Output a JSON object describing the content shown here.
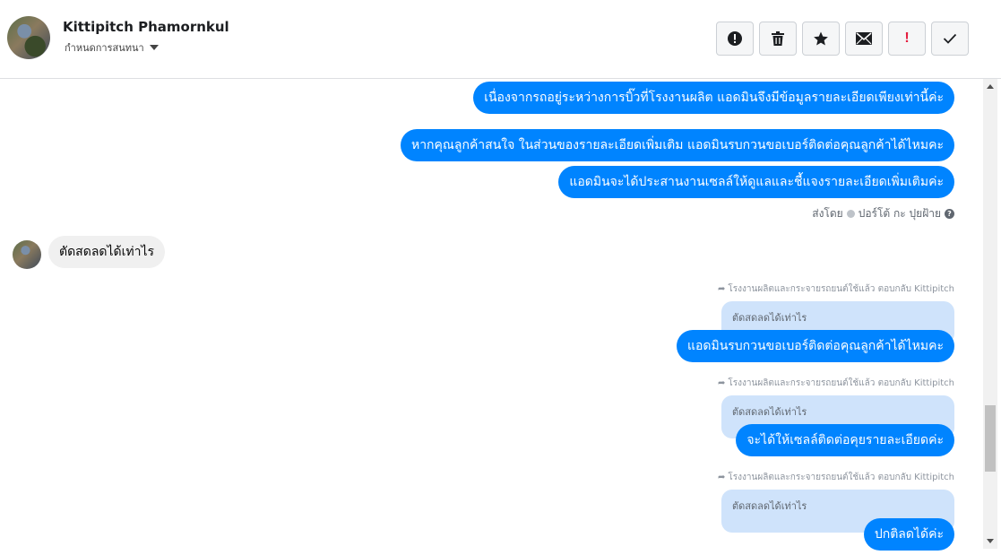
{
  "header": {
    "contact_name": "Kittipitch Phamornkul",
    "conversation_status": "กำหนดการสนทนา",
    "toolbar": [
      {
        "name": "spam-alert-icon"
      },
      {
        "name": "trash-icon"
      },
      {
        "name": "star-icon"
      },
      {
        "name": "envelope-icon"
      },
      {
        "name": "exclamation-icon"
      },
      {
        "name": "checkmark-icon"
      }
    ]
  },
  "messages": {
    "out_1": "เนื่องจากรถอยู่ระหว่างการบิ๊วที่โรงงานผลิต แอดมินจึงมีข้อมูลรายละเอียดเพียงเท่านี้ค่ะ",
    "out_2": "หากคุณลูกค้าสนใจ ในส่วนของรายละเอียดเพิ่มเติม แอดมินรบกวนขอเบอร์ติดต่อคุณลูกค้าได้ไหมคะ",
    "out_3": "แอดมินจะได้ประสานงานเซลล์ให้ดูแลและชี้แจงรายละเอียดเพิ่มเติมค่ะ",
    "sent_by_prefix": "ส่งโดย",
    "sent_by_name": "ปอร์โต้ กะ ปุยฝ้าย",
    "in_1": "ตัดสดลดได้เท่าไร",
    "reply_note": "โรงงานผลิตและกระจายรถยนต์ใช้แล้ว ตอบกลับ Kittipitch",
    "quoted_text": "ตัดสดลดได้เท่าไร",
    "reply_1": "แอดมินรบกวนขอเบอร์ติดต่อคุณลูกค้าได้ไหมคะ",
    "reply_2": "จะได้ให้เซลล์ติดต่อคุยรายละเอียดค่ะ",
    "reply_3": "ปกติลดได้ค่ะ"
  },
  "colors": {
    "outgoing_bubble": "#0084ff",
    "incoming_bubble": "#f0f0f0",
    "quote_background": "#cfe3fb"
  }
}
